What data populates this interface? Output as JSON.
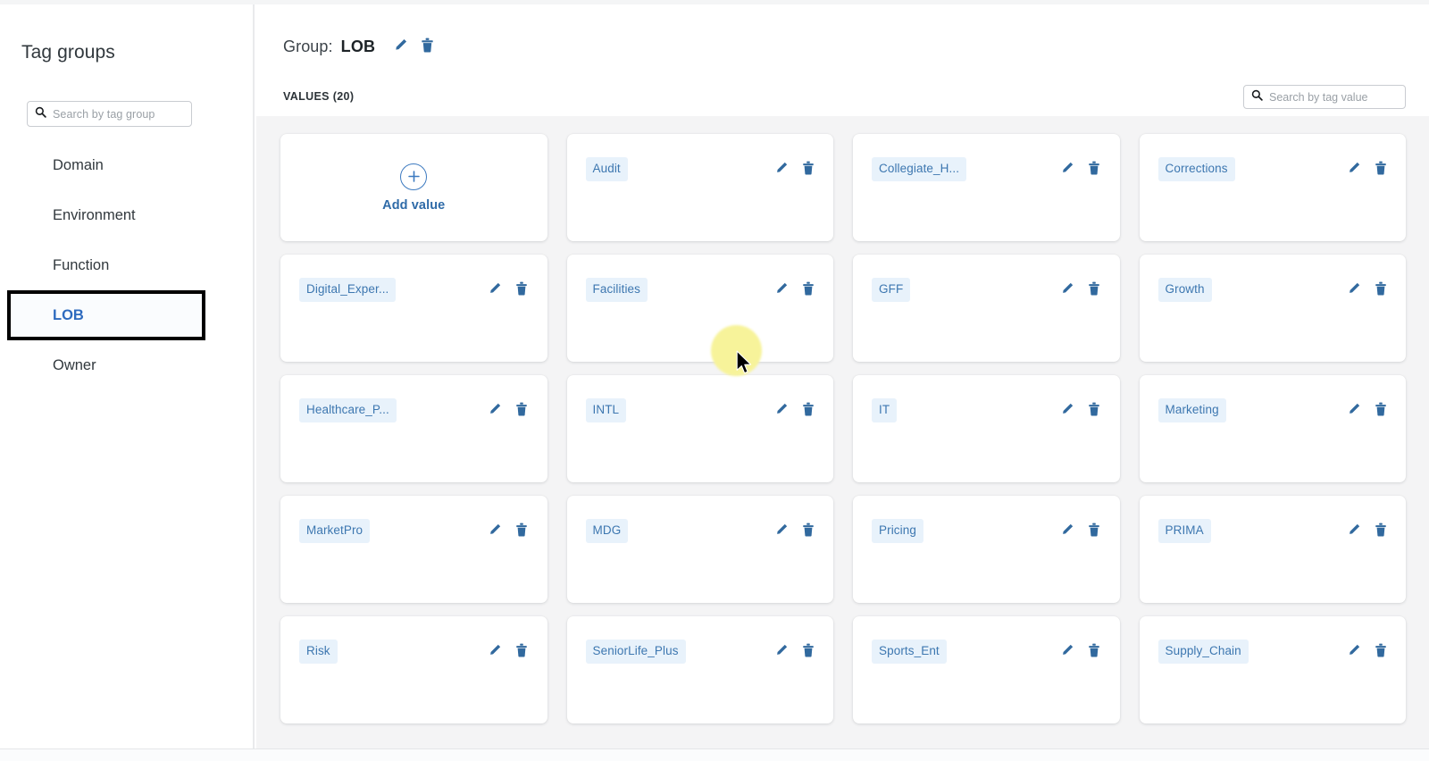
{
  "sidebar": {
    "title": "Tag groups",
    "search": {
      "placeholder": "Search by tag group",
      "icon": "search-icon",
      "value": ""
    },
    "items": [
      {
        "label": "Domain",
        "selected": false
      },
      {
        "label": "Environment",
        "selected": false
      },
      {
        "label": "Function",
        "selected": false
      },
      {
        "label": "LOB",
        "selected": true
      },
      {
        "label": "Owner",
        "selected": false
      }
    ]
  },
  "main": {
    "group_label": "Group:",
    "group_name": "LOB",
    "group_edit_icon": "pencil-icon",
    "group_delete_icon": "trash-icon",
    "values_label": "VALUES (20)",
    "search": {
      "placeholder": "Search by tag value",
      "icon": "search-icon",
      "value": ""
    },
    "add_card": {
      "label": "Add value",
      "icon": "plus-circle-icon"
    },
    "row_edit_icon": "pencil-icon",
    "row_delete_icon": "trash-icon",
    "values": [
      {
        "label": "Audit",
        "truncated": false
      },
      {
        "label": "Collegiate_H...",
        "truncated": true
      },
      {
        "label": "Corrections",
        "truncated": false
      },
      {
        "label": "Digital_Exper...",
        "truncated": true
      },
      {
        "label": "Facilities",
        "truncated": false
      },
      {
        "label": "GFF",
        "truncated": false
      },
      {
        "label": "Growth",
        "truncated": false
      },
      {
        "label": "Healthcare_P...",
        "truncated": true
      },
      {
        "label": "INTL",
        "truncated": false
      },
      {
        "label": "IT",
        "truncated": false
      },
      {
        "label": "Marketing",
        "truncated": false
      },
      {
        "label": "MarketPro",
        "truncated": false
      },
      {
        "label": "MDG",
        "truncated": false
      },
      {
        "label": "Pricing",
        "truncated": false
      },
      {
        "label": "PRIMA",
        "truncated": false
      },
      {
        "label": "Risk",
        "truncated": false
      },
      {
        "label": "SeniorLife_Plus",
        "truncated": false
      },
      {
        "label": "Sports_Ent",
        "truncated": false
      },
      {
        "label": "Supply_Chain",
        "truncated": false
      }
    ]
  },
  "colors": {
    "accent_blue": "#3d77b0",
    "chip_background": "#e8f2fb",
    "link_blue": "#2e6bbf",
    "icon_blue": "#31699e",
    "panel_background": "#f4f4f5",
    "cursor_highlight": "#f7f39a",
    "focus_ring": "#000000"
  }
}
